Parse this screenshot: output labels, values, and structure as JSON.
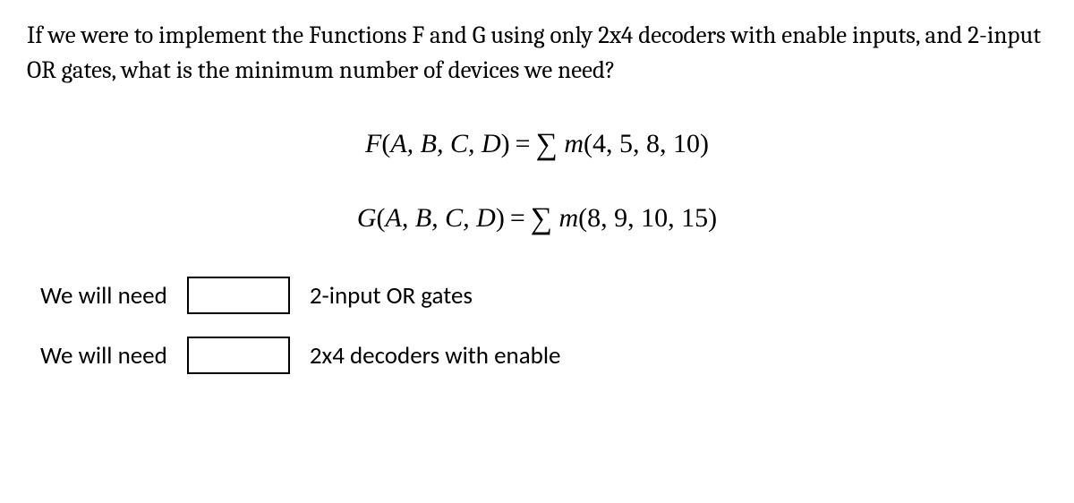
{
  "question": "If we were to implement the Functions F and G using only 2x4 decoders with enable inputs, and 2-input OR gates, what is the minimum number of devices we need?",
  "formulas": {
    "f": {
      "func": "F",
      "vars": "A, B, C, D",
      "minterms": "4, 5, 8, 10"
    },
    "g": {
      "func": "G",
      "vars": "A, B, C, D",
      "minterms": "8, 9, 10, 15"
    }
  },
  "answers": {
    "row1": {
      "prefix": "We will need",
      "value": "",
      "suffix": "2-input OR gates"
    },
    "row2": {
      "prefix": "We will need",
      "value": "",
      "suffix": "2x4 decoders with enable"
    }
  }
}
